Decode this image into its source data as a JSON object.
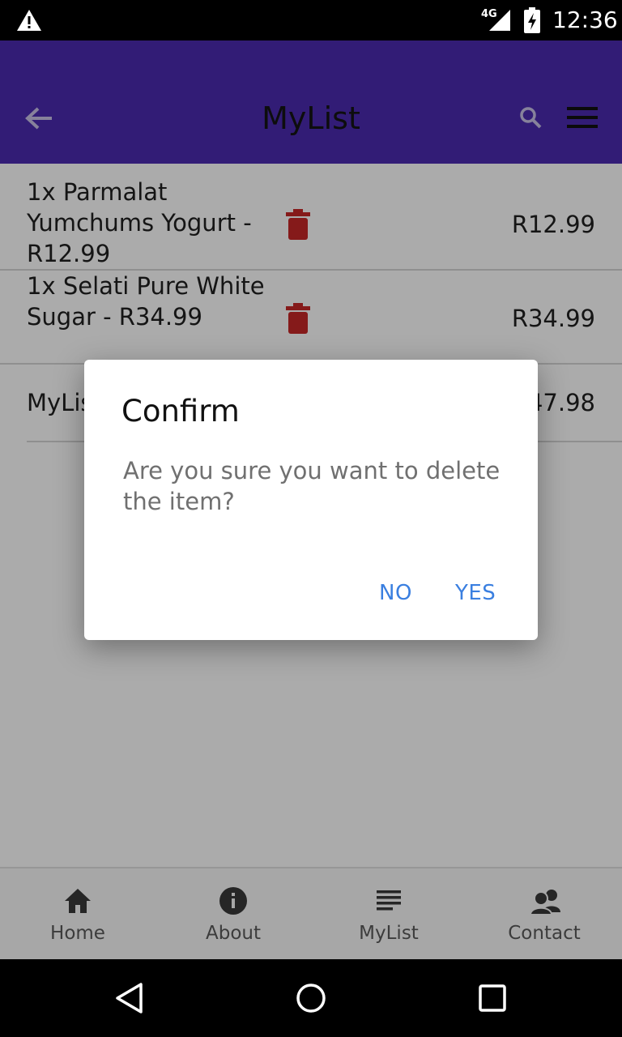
{
  "status_bar": {
    "time": "12:36",
    "network_type": "4G"
  },
  "app_bar": {
    "title": "MyList",
    "color": "#4b2bb0"
  },
  "list": {
    "items": [
      {
        "name": "1x Parmalat Yumchums Yogurt - R12.99",
        "price": "R12.99"
      },
      {
        "name": "1x Selati Pure White Sugar - R34.99",
        "price": "R34.99"
      }
    ],
    "total_label": "MyList",
    "total_value": "R47.98"
  },
  "bottom_nav": {
    "items": [
      {
        "label": "Home",
        "icon": "home-icon"
      },
      {
        "label": "About",
        "icon": "info-icon"
      },
      {
        "label": "MyList",
        "icon": "list-icon"
      },
      {
        "label": "Contact",
        "icon": "people-icon"
      }
    ]
  },
  "dialog": {
    "title": "Confirm",
    "message": "Are you sure you want to delete the item?",
    "no_label": "NO",
    "yes_label": "YES",
    "button_color": "#3a7fe0"
  },
  "colors": {
    "trash": "#c62828"
  }
}
